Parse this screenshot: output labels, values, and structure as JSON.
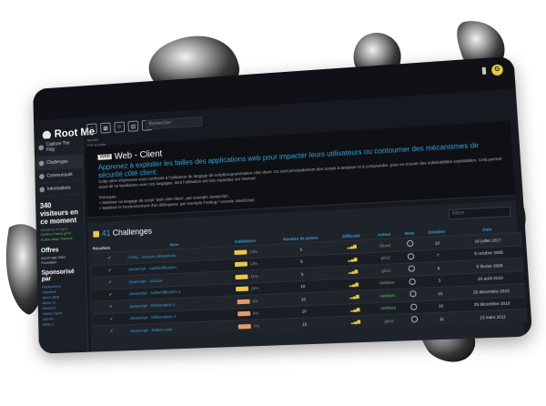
{
  "colors": {
    "accent": "#35a0d8",
    "success": "#5bc26a",
    "warning": "#e7c84a",
    "bg": "#16191f"
  },
  "app": {
    "logo": "Root Me",
    "search_placeholder": "Rechercher",
    "avatar_initial": "G"
  },
  "sidebar": {
    "items": [
      {
        "label": "Capture The Flag",
        "icon": "flag-icon"
      },
      {
        "label": "Challenges",
        "icon": "target-icon",
        "active": true
      },
      {
        "label": "Communauté",
        "icon": "users-icon"
      },
      {
        "label": "Informations",
        "icon": "info-icon"
      }
    ],
    "visitors": "340 visiteurs en ce moment",
    "visitors_note": "membres en ligne",
    "visitors_online": [
      "Guiidoo    Fraxio    g0u2",
      "Hulbin    dlaar    Thebest"
    ],
    "offers_title": "Offres",
    "offers_text": "ROOT-ME PRO Formation",
    "sponsor_title": "Sponsorisé par",
    "sponsors": [
      "Hackgothica",
      "Helpdesk",
      "Opzor BBB",
      "Alpha 0x",
      "Mankind",
      "Vantra Cyber",
      "Splunk",
      "Wisly 1"
    ]
  },
  "breadcrumbs": [
    "Accueil",
    "CTF & Défis"
  ],
  "page": {
    "tag": "Web",
    "title": "Web - Client",
    "subtitle": "Apprenez à exploiter les failles des applications web pour impacter leurs utilisateurs ou contourner des mécanismes de sécurité côté client.",
    "description": "Cette série d'épreuves vous confronte à l'utilisation de langage de script/programmation côté client. Ce sont principalement des scripts à analyser et à comprendre, pour en trouver des vulnérabilités exploitables. Cela permet aussi de se familiariser avec ces langages, dont l'utilisation est très répandue sur Internet.",
    "prereq_title": "Prérequis :",
    "prereq": [
      "Maitriser un langage de script \"web côté client\", par exemple Javascript ;",
      "Maitriser le fonctionnement d'un débogueur, par exemple Firebug / console JavaScript."
    ]
  },
  "challenges": {
    "count": "41",
    "title": "Challenges",
    "filter_placeholder": "Filtrer",
    "columns": [
      "Résultats",
      "Nom",
      "Validations",
      "Nombre de points",
      "Difficulté",
      "Auteur",
      "Note",
      "Solution",
      "Date"
    ],
    "rows": [
      {
        "name": "HTML - boutons désactivés",
        "validations": "14%",
        "bar_color": "#e7c84a",
        "points": "5",
        "author": "Cloud",
        "author_style": "green",
        "solutions": "10",
        "date": "16 juillet 2017"
      },
      {
        "name": "Javascript - Authentification",
        "validations": "13%",
        "bar_color": "#e7c84a",
        "points": "5",
        "author": "g0u2",
        "author_style": "grey",
        "solutions": "7",
        "date": "8 octobre 2006"
      },
      {
        "name": "Javascript - Source",
        "validations": "11%",
        "bar_color": "#e7c84a",
        "points": "5",
        "author": "g0u2",
        "author_style": "grey",
        "solutions": "5",
        "date": "5 février 2006"
      },
      {
        "name": "Javascript - Authentification 2",
        "validations": "10%",
        "bar_color": "#e7c84a",
        "points": "10",
        "author": "Hel0ism",
        "author_style": "green",
        "solutions": "3",
        "date": "20 août 2010"
      },
      {
        "name": "Javascript - Obfuscation 1",
        "validations": "9%",
        "bar_color": "#e59a6a",
        "points": "10",
        "author": "Hel0ism",
        "author_style": "green",
        "solutions": "10",
        "date": "25 décembre 2010"
      },
      {
        "name": "Javascript - Obfuscation 2",
        "validations": "8%",
        "bar_color": "#e59a6a",
        "points": "10",
        "author": "Hel0ism",
        "author_style": "green",
        "solutions": "10",
        "date": "25 décembre 2010"
      },
      {
        "name": "Javascript - Native code",
        "validations": "7%",
        "bar_color": "#e59a6a",
        "points": "15",
        "author": "g0u2",
        "author_style": "grey",
        "solutions": "11",
        "date": "13 mars 2011"
      }
    ]
  }
}
